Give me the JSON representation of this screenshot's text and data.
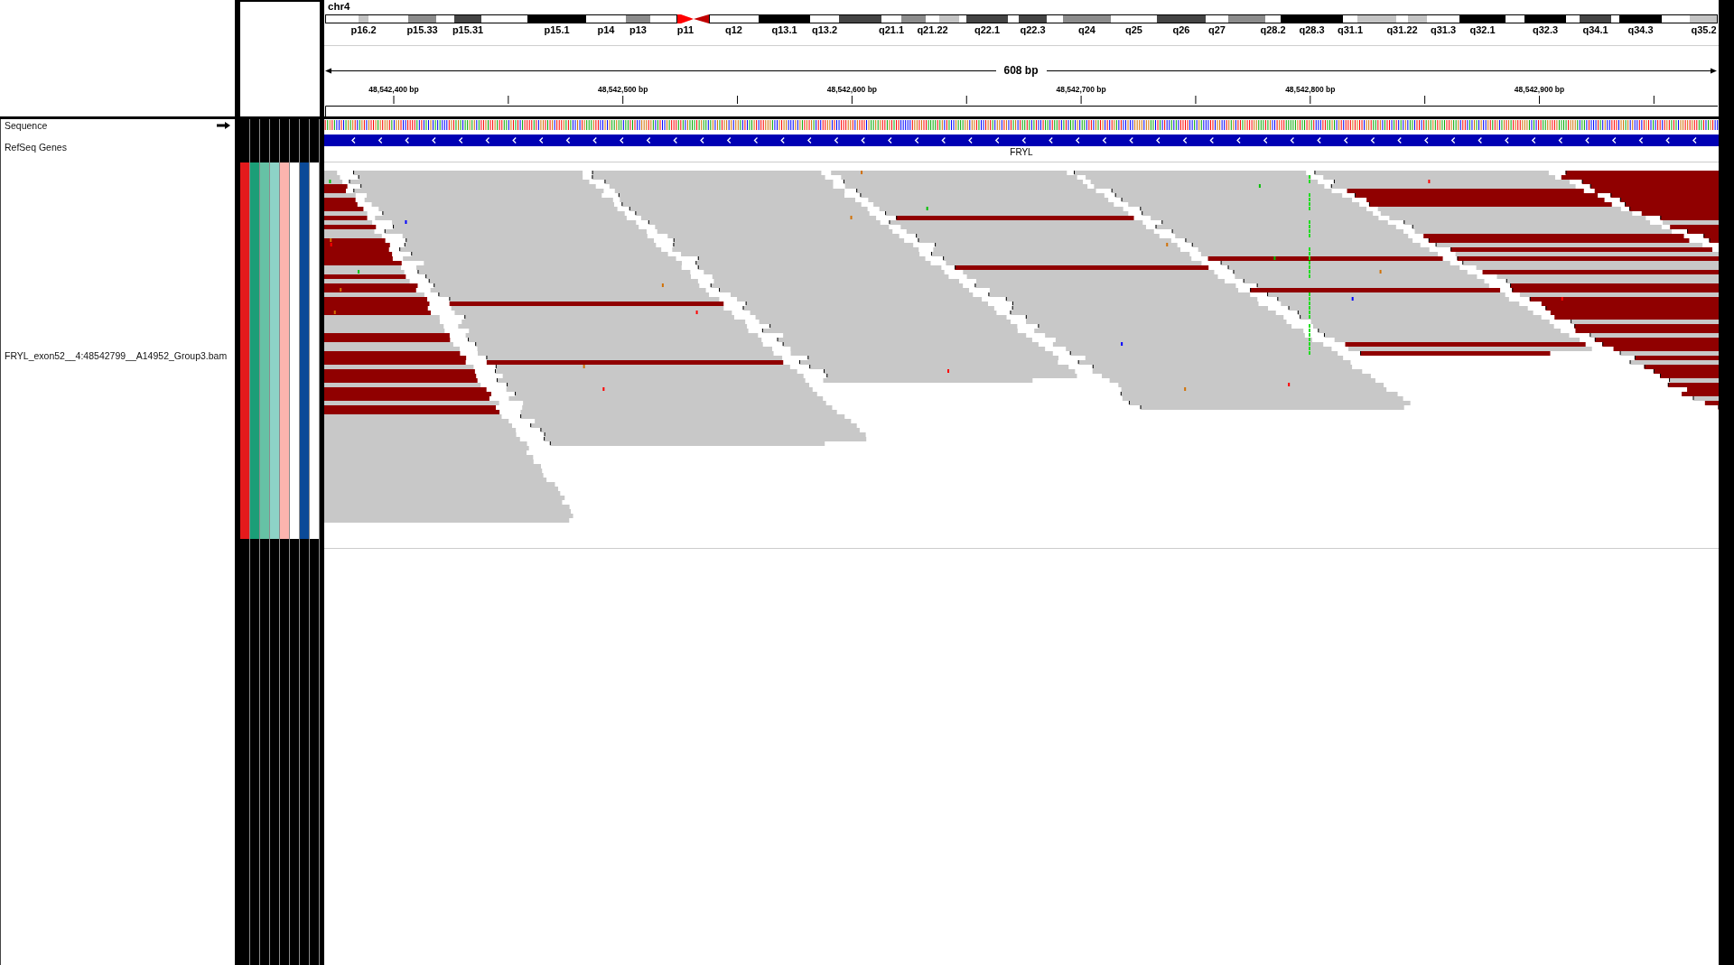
{
  "ideogram": {
    "chromosome": "chr4",
    "bands": [
      {
        "kind": "gneg"
      },
      {
        "kind": "gpos25",
        "label": "p16.2"
      },
      {
        "kind": "gneg"
      },
      {
        "kind": "gpos50",
        "label": "p15.33"
      },
      {
        "kind": "gneg"
      },
      {
        "kind": "gpos75",
        "label": "p15.31"
      },
      {
        "kind": "gneg"
      },
      {
        "kind": "gpos100",
        "label": "p15.1"
      },
      {
        "kind": "gneg",
        "label": "p14"
      },
      {
        "kind": "gpos50",
        "label": "p13"
      },
      {
        "kind": "gneg"
      },
      {
        "kind": "acen",
        "label": "p11"
      },
      {
        "kind": "acen"
      },
      {
        "kind": "gneg",
        "label": "q12"
      },
      {
        "kind": "gpos100",
        "label": "q13.1"
      },
      {
        "kind": "gneg",
        "label": "q13.2"
      },
      {
        "kind": "gpos75"
      },
      {
        "kind": "gneg",
        "label": "q21.1"
      },
      {
        "kind": "gpos50"
      },
      {
        "kind": "gneg",
        "label": "q21.22"
      },
      {
        "kind": "gpos25"
      },
      {
        "kind": "gneg"
      },
      {
        "kind": "gpos75",
        "label": "q22.1"
      },
      {
        "kind": "gneg"
      },
      {
        "kind": "gpos75",
        "label": "q22.3"
      },
      {
        "kind": "gneg"
      },
      {
        "kind": "gpos50",
        "label": "q24"
      },
      {
        "kind": "gneg",
        "label": "q25"
      },
      {
        "kind": "gpos75",
        "label": "q26"
      },
      {
        "kind": "gneg",
        "label": "q27"
      },
      {
        "kind": "gpos50"
      },
      {
        "kind": "gneg",
        "label": "q28.2"
      },
      {
        "kind": "gpos100",
        "label": "q28.3"
      },
      {
        "kind": "gneg",
        "label": "q31.1"
      },
      {
        "kind": "gpos25"
      },
      {
        "kind": "gneg",
        "label": "q31.22"
      },
      {
        "kind": "gpos25"
      },
      {
        "kind": "gneg",
        "label": "q31.3"
      },
      {
        "kind": "gpos100",
        "label": "q32.1"
      },
      {
        "kind": "gneg"
      },
      {
        "kind": "gpos100",
        "label": "q32.3"
      },
      {
        "kind": "gneg"
      },
      {
        "kind": "gpos75",
        "label": "q34.1"
      },
      {
        "kind": "gneg"
      },
      {
        "kind": "gpos100",
        "label": "q34.3"
      },
      {
        "kind": "gneg"
      },
      {
        "kind": "gpos25",
        "label": "q35.2"
      }
    ]
  },
  "ruler": {
    "span": "608 bp",
    "ticks": [
      "48,542,400 bp",
      "48,542,500 bp",
      "48,542,600 bp",
      "48,542,700 bp",
      "48,542,800 bp",
      "48,542,900 bp"
    ]
  },
  "tracks": [
    {
      "kind": "sequence",
      "name": "Sequence",
      "forward": true
    },
    {
      "kind": "genes",
      "name": "RefSeq Genes",
      "genes": [
        {
          "name": "FRYL",
          "forward": false
        }
      ]
    },
    {
      "kind": "alignment",
      "name": "FRYL_exon52__4:48542799__A14952_Group3.bam",
      "attributes": [
        {
          "color": "#e41a1c"
        },
        {
          "color": "#1b9e77"
        },
        {
          "color": "#66c2a5"
        },
        {
          "color": "#8dd3c7"
        },
        {
          "color": "#fbb4ae"
        },
        {
          "color": "#ffffff"
        },
        {
          "color": "#0b4a98"
        },
        {
          "color": "#ffffff"
        }
      ]
    }
  ]
}
